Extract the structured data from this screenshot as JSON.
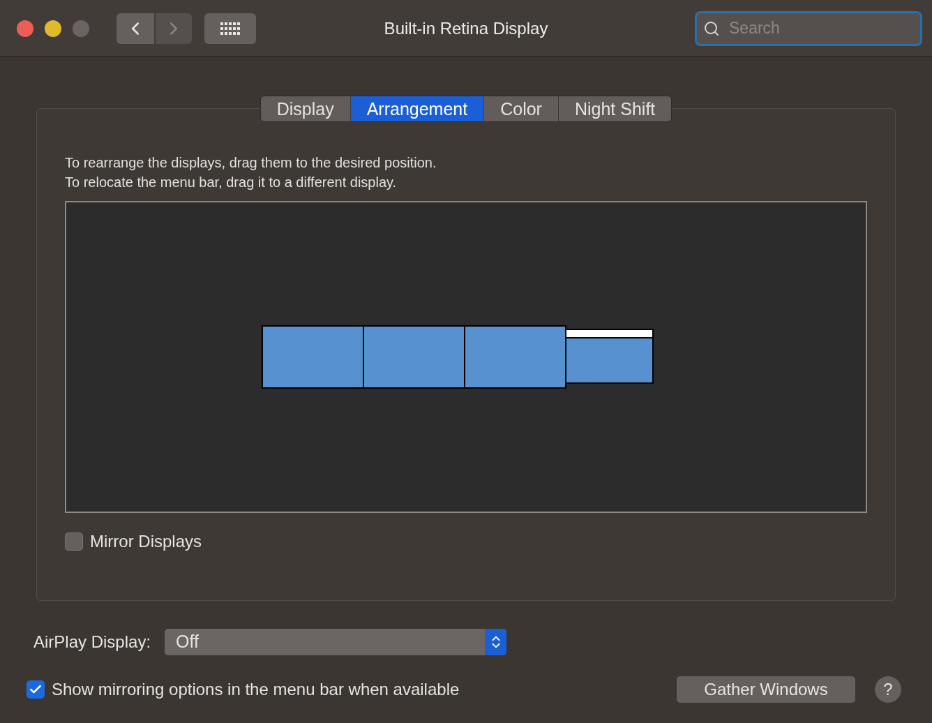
{
  "window": {
    "title": "Built-in Retina Display"
  },
  "search": {
    "placeholder": "Search"
  },
  "tabs": [
    {
      "label": "Display",
      "selected": false
    },
    {
      "label": "Arrangement",
      "selected": true
    },
    {
      "label": "Color",
      "selected": false
    },
    {
      "label": "Night Shift",
      "selected": false
    }
  ],
  "instructions": [
    "To rearrange the displays, drag them to the desired position.",
    "To relocate the menu bar, drag it to a different display."
  ],
  "displays": [
    {
      "has_menu_bar": false
    },
    {
      "has_menu_bar": false
    },
    {
      "has_menu_bar": false
    },
    {
      "has_menu_bar": true
    }
  ],
  "mirror_displays": {
    "label": "Mirror Displays",
    "checked": false
  },
  "airplay": {
    "label": "AirPlay Display:",
    "value": "Off"
  },
  "show_mirroring": {
    "label": "Show mirroring options in the menu bar when available",
    "checked": true
  },
  "gather_button": "Gather Windows",
  "help_button": "?"
}
